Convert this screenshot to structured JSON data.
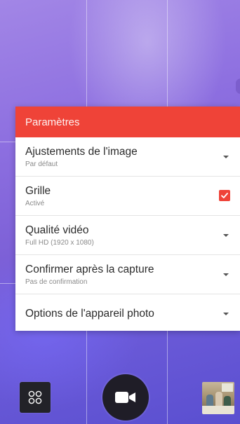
{
  "settings_panel": {
    "title": "Paramètres",
    "items": [
      {
        "title": "Ajustements de l'image",
        "value": "Par défaut",
        "control": "dropdown"
      },
      {
        "title": "Grille",
        "value": "Activé",
        "control": "checkbox",
        "checked": true
      },
      {
        "title": "Qualité vidéo",
        "value": "Full HD (1920 x 1080)",
        "control": "dropdown"
      },
      {
        "title": "Confirmer après la capture",
        "value": "Pas de confirmation",
        "control": "dropdown"
      },
      {
        "title": "Options de l'appareil photo",
        "control": "dropdown"
      }
    ]
  },
  "bottom_bar": {
    "mode_icon": "grid-four-circles-icon",
    "record_icon": "video-camera-icon",
    "gallery_icon": "gallery-thumbnail"
  },
  "colors": {
    "accent": "#ef4338",
    "panel_background": "#ffffff",
    "viewfinder_background": "#7b5fd6"
  }
}
